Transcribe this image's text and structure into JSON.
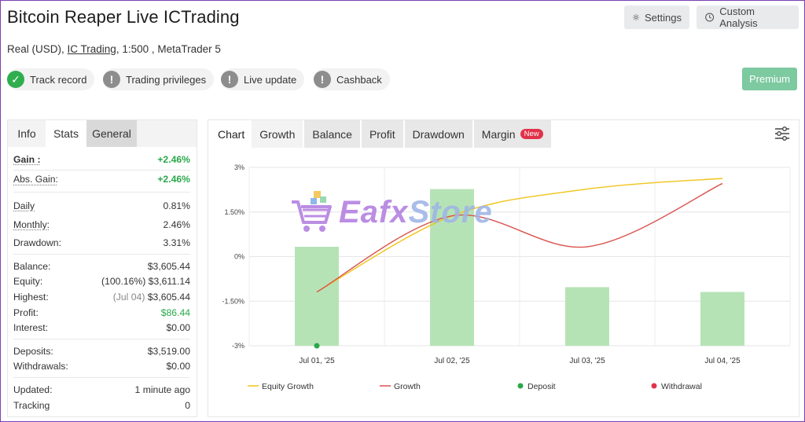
{
  "header": {
    "title": "Bitcoin Reaper Live ICTrading",
    "settings_label": "Settings",
    "custom_analysis_label": "Custom Analysis",
    "account_type": "Real (USD),",
    "broker": "IC Trading",
    "leverage_platform": ", 1:500 , MetaTrader 5",
    "premium_label": "Premium"
  },
  "badges": [
    {
      "label": "Track record",
      "state": "ok"
    },
    {
      "label": "Trading privileges",
      "state": "warn"
    },
    {
      "label": "Live update",
      "state": "warn"
    },
    {
      "label": "Cashback",
      "state": "warn"
    }
  ],
  "left_tabs": [
    "Info",
    "Stats",
    "General"
  ],
  "stats": {
    "gain": {
      "label": "Gain :",
      "value": "+2.46%"
    },
    "abs_gain": {
      "label": "Abs. Gain:",
      "value": "+2.46%"
    },
    "daily": {
      "label": "Daily",
      "value": "0.81%"
    },
    "monthly": {
      "label": "Monthly:",
      "value": "2.46%"
    },
    "drawdown": {
      "label": "Drawdown:",
      "value": "3.31%"
    },
    "balance": {
      "label": "Balance:",
      "value": "$3,605.44"
    },
    "equity": {
      "label": "Equity:",
      "prefix": "(100.16%)",
      "value": "$3,611.14"
    },
    "highest": {
      "label": "Highest:",
      "prefix": "(Jul 04)",
      "value": "$3,605.44"
    },
    "profit": {
      "label": "Profit:",
      "value": "$86.44"
    },
    "interest": {
      "label": "Interest:",
      "value": "$0.00"
    },
    "deposits": {
      "label": "Deposits:",
      "value": "$3,519.00"
    },
    "withdrawals": {
      "label": "Withdrawals:",
      "value": "$0.00"
    },
    "updated": {
      "label": "Updated:",
      "value": "1 minute ago"
    },
    "tracking": {
      "label": "Tracking",
      "value": "0"
    }
  },
  "chart_tabs": [
    "Chart",
    "Growth",
    "Balance",
    "Profit",
    "Drawdown",
    "Margin"
  ],
  "new_badge": "New",
  "watermark": {
    "part1": "Eafx",
    "part2": "Store"
  },
  "colors": {
    "equity_growth": "#f0c419",
    "growth": "#d9534f",
    "deposit": "#2aa84a",
    "withdrawal": "#e0334a",
    "bar": "#b6e3b6"
  },
  "chart_data": {
    "type": "bar",
    "categories": [
      "Jul 01, '25",
      "Jul 02, '25",
      "Jul 03, '25",
      "Jul 04, '25"
    ],
    "y_ticks": [
      "3%",
      "1.50%",
      "0%",
      "-1.50%",
      "-3%"
    ],
    "ylim": [
      -3,
      3
    ],
    "bar_values": [
      0.33,
      2.27,
      -1.03,
      -1.19
    ],
    "series": [
      {
        "name": "Equity Growth",
        "values": [
          -1.19,
          1.37,
          2.27,
          2.63
        ]
      },
      {
        "name": "Growth",
        "values": [
          -1.19,
          1.37,
          0.33,
          2.46
        ]
      }
    ],
    "deposit_points": [
      {
        "x": "Jul 01, '25",
        "y": -3
      }
    ],
    "legend": [
      "Equity Growth",
      "Growth",
      "Deposit",
      "Withdrawal"
    ],
    "legend_position": "bottom",
    "grid": true
  }
}
